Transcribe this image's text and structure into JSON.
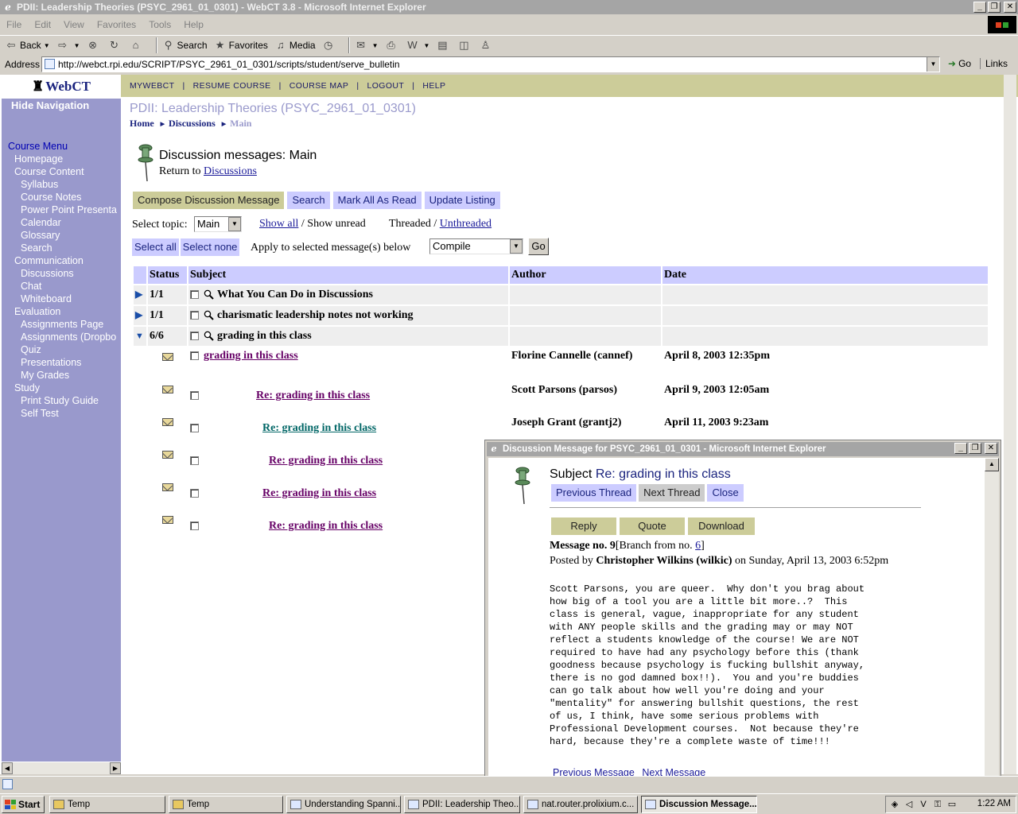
{
  "window": {
    "title": "PDII: Leadership Theories (PSYC_2961_01_0301) - WebCT 3.8 - Microsoft Internet Explorer"
  },
  "menubar": [
    "File",
    "Edit",
    "View",
    "Favorites",
    "Tools",
    "Help"
  ],
  "toolbar": {
    "back": "Back",
    "search": "Search",
    "favorites": "Favorites",
    "media": "Media"
  },
  "address": {
    "label": "Address",
    "url": "http://webct.rpi.edu/SCRIPT/PSYC_2961_01_0301/scripts/student/serve_bulletin",
    "go": "Go",
    "links": "Links"
  },
  "nav": {
    "logo": "WebCT",
    "hide": "Hide Navigation",
    "items": [
      {
        "label": "Course Menu",
        "level": "hd"
      },
      {
        "label": "Homepage",
        "level": "l1"
      },
      {
        "label": "Course Content",
        "level": "l1"
      },
      {
        "label": "Syllabus",
        "level": "l2"
      },
      {
        "label": "Course Notes",
        "level": "l2"
      },
      {
        "label": "Power Point Presenta",
        "level": "l2"
      },
      {
        "label": "Calendar",
        "level": "l2"
      },
      {
        "label": "Glossary",
        "level": "l2"
      },
      {
        "label": "Search",
        "level": "l2"
      },
      {
        "label": "Communication",
        "level": "l1"
      },
      {
        "label": "Discussions",
        "level": "l2"
      },
      {
        "label": "Chat",
        "level": "l2"
      },
      {
        "label": "Whiteboard",
        "level": "l2"
      },
      {
        "label": "Evaluation",
        "level": "l1"
      },
      {
        "label": "Assignments Page",
        "level": "l2"
      },
      {
        "label": "Assignments (Dropbo",
        "level": "l2"
      },
      {
        "label": "Quiz",
        "level": "l2"
      },
      {
        "label": "Presentations",
        "level": "l2"
      },
      {
        "label": "My Grades",
        "level": "l2"
      },
      {
        "label": "Study",
        "level": "l1"
      },
      {
        "label": "Print Study Guide",
        "level": "l2"
      },
      {
        "label": "Self Test",
        "level": "l2"
      }
    ]
  },
  "topnav": [
    "MYWEBCT",
    "RESUME COURSE",
    "COURSE MAP",
    "LOGOUT",
    "HELP"
  ],
  "course_title": "PDII: Leadership Theories (PSYC_2961_01_0301)",
  "breadcrumb": {
    "home": "Home",
    "discussions": "Discussions",
    "current": "Main"
  },
  "heading": "Discussion messages: Main",
  "return": {
    "prefix": "Return to",
    "link": "Discussions"
  },
  "actions": {
    "compose": "Compose Discussion Message",
    "search": "Search",
    "mark_all": "Mark All As Read",
    "update": "Update Listing"
  },
  "topic": {
    "label": "Select topic:",
    "value": "Main",
    "show_all": "Show all",
    "show_unread": "/ Show unread",
    "threaded": "Threaded /",
    "unthreaded": "Unthreaded"
  },
  "selection": {
    "select_all": "Select all",
    "select_none": "Select none",
    "apply_label": "Apply to selected message(s) below",
    "apply_value": "Compile",
    "go": "Go"
  },
  "table": {
    "headers": [
      "Status",
      "Subject",
      "Author",
      "Date"
    ],
    "threads": [
      {
        "status": "1/1",
        "subject": "What You Can Do in Discussions"
      },
      {
        "status": "1/1",
        "subject": "charismatic leadership notes not working"
      },
      {
        "status": "6/6",
        "subject": "grading in this class"
      }
    ],
    "messages": [
      {
        "subject": "grading in this class",
        "author": "Florine Cannelle (cannef)",
        "date": "April 8, 2003 12:35pm"
      },
      {
        "subject": "Re: grading in this class",
        "author": "Scott Parsons (parsos)",
        "date": "April 9, 2003 12:05am"
      },
      {
        "subject": "Re: grading in this class",
        "author": "Joseph Grant (grantj2)",
        "date": "April 11, 2003 9:23am"
      },
      {
        "subject": "Re: grading in this class",
        "author": "",
        "date": ""
      },
      {
        "subject": "Re: grading in this class",
        "author": "",
        "date": ""
      },
      {
        "subject": "Re: grading in this class",
        "author": "",
        "date": ""
      }
    ]
  },
  "popup": {
    "title": "Discussion Message for PSYC_2961_01_0301 - Microsoft Internet Explorer",
    "subject_label": "Subject",
    "subject_value": "Re: grading in this class",
    "prev_thread": "Previous Thread",
    "next_thread": "Next Thread",
    "close": "Close",
    "reply": "Reply",
    "quote": "Quote",
    "download": "Download",
    "message_no": "Message no. 9",
    "branch_prefix": "[Branch from no.",
    "branch_no": "6",
    "branch_suffix": "]",
    "posted_by": "Posted by",
    "author": "Christopher Wilkins (wilkic)",
    "posted_on": "on Sunday, April 13, 2003 6:52pm",
    "body": "Scott Parsons, you are queer.  Why don't you brag about\nhow big of a tool you are a little bit more..?  This\nclass is general, vague, inappropriate for any student\nwith ANY people skills and the grading may or may NOT\nreflect a students knowledge of the course! We are NOT\nrequired to have had any psychology before this (thank\ngoodness because psychology is fucking bullshit anyway,\nthere is no god damned box!!).  You and you're buddies\ncan go talk about how well you're doing and your\n\"mentality\" for answering bullshit questions, the rest\nof us, I think, have some serious problems with\nProfessional Development courses.  Not because they're\nhard, because they're a complete waste of time!!!",
    "prev_message": "Previous Message",
    "next_message": "Next Message"
  },
  "taskbar": {
    "start": "Start",
    "tasks": [
      {
        "label": "Temp",
        "active": false
      },
      {
        "label": "Temp",
        "active": false
      },
      {
        "label": "Understanding Spanni...",
        "active": false
      },
      {
        "label": "PDII: Leadership Theo...",
        "active": false
      },
      {
        "label": "nat.router.prolixium.c...",
        "active": false
      },
      {
        "label": "Discussion Message...",
        "active": true
      }
    ],
    "clock": "1:22 AM"
  },
  "colors": {
    "nav_bg": "#9999cc",
    "topbar_bg": "#cccc99",
    "header_bg": "#ccccff",
    "thread_bg": "#eeeeee",
    "link_visited": "#660066"
  }
}
